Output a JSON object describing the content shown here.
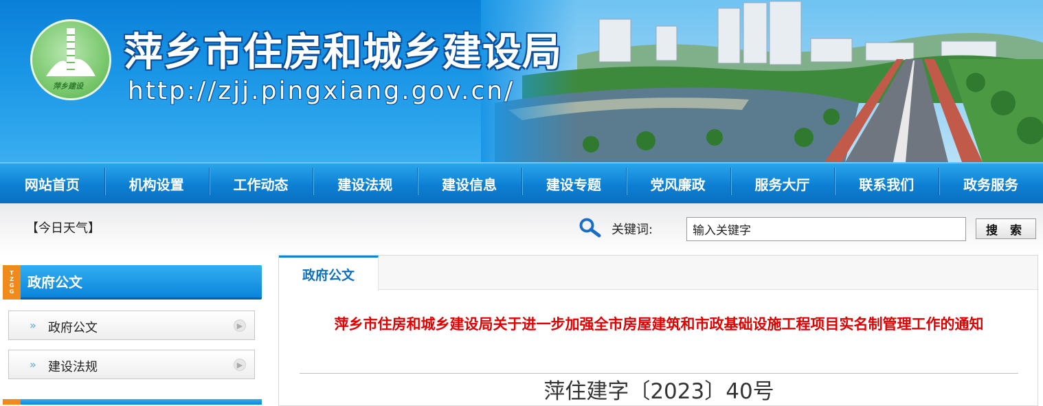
{
  "header": {
    "title": "萍乡市住房和城乡建设局",
    "url": "http://zjj.pingxiang.gov.cn/",
    "logo_text": "萍乡建设"
  },
  "nav": {
    "items": [
      "网站首页",
      "机构设置",
      "工作动态",
      "建设法规",
      "建设信息",
      "建设专题",
      "党风廉政",
      "服务大厅",
      "联系我们",
      "政务服务"
    ]
  },
  "utility": {
    "weather": "【今日天气】",
    "search_label": "关键词:",
    "search_value": "输入关键字",
    "search_button": "搜 索"
  },
  "sidebar": {
    "tag": "TZGG",
    "title": "政府公文",
    "items": [
      {
        "label": "政府公文"
      },
      {
        "label": "建设法规"
      }
    ]
  },
  "main": {
    "tab": "政府公文",
    "article_title": "萍乡市住房和城乡建设局关于进一步加强全市房屋建筑和市政基础设施工程项目实名制管理工作的通知",
    "doc_number": "萍住建字〔2023〕40号"
  },
  "colors": {
    "primary_blue": "#0d84d6",
    "nav_blue": "#0a6fc0",
    "title_red": "#e10000",
    "tag_orange": "#f08a1c"
  }
}
